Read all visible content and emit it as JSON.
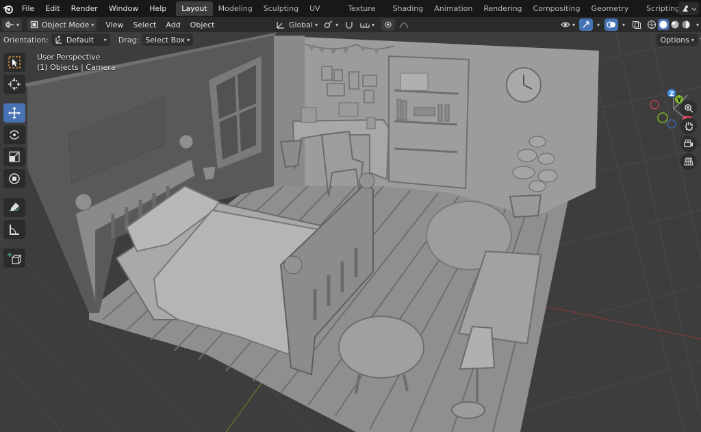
{
  "app": {
    "name": "Blender"
  },
  "menu": [
    "File",
    "Edit",
    "Render",
    "Window",
    "Help"
  ],
  "workspaces": [
    {
      "label": "Layout",
      "active": true
    },
    {
      "label": "Modeling"
    },
    {
      "label": "Sculpting"
    },
    {
      "label": "UV Editing"
    },
    {
      "label": "Texture Paint"
    },
    {
      "label": "Shading"
    },
    {
      "label": "Animation"
    },
    {
      "label": "Rendering"
    },
    {
      "label": "Compositing"
    },
    {
      "label": "Geometry Nodes"
    },
    {
      "label": "Scripting"
    }
  ],
  "header": {
    "mode": "Object Mode",
    "menus": [
      "View",
      "Select",
      "Add",
      "Object"
    ],
    "transform_orientation": "Global"
  },
  "tool_settings": {
    "orientation_label": "Orientation:",
    "orientation_value": "Default",
    "drag_label": "Drag:",
    "drag_value": "Select Box",
    "options_label": "Options"
  },
  "viewport": {
    "perspective": "User Perspective",
    "collection": "(1) Objects | Camera"
  },
  "gizmo": {
    "x": "X",
    "y": "Y",
    "z": "Z"
  },
  "colors": {
    "accent": "#4772b3",
    "topbar": "#181818",
    "header": "#2b2b2b",
    "viewport_bg": "#3d3d3d",
    "axis_x": "#e3485b",
    "axis_y": "#7fb42f",
    "axis_z": "#3f8fe5"
  },
  "tools": [
    "select-box-icon",
    "cursor-icon",
    "move-icon",
    "rotate-icon",
    "scale-icon",
    "transform-icon",
    "annotate-icon",
    "measure-icon",
    "add-cube-icon"
  ]
}
